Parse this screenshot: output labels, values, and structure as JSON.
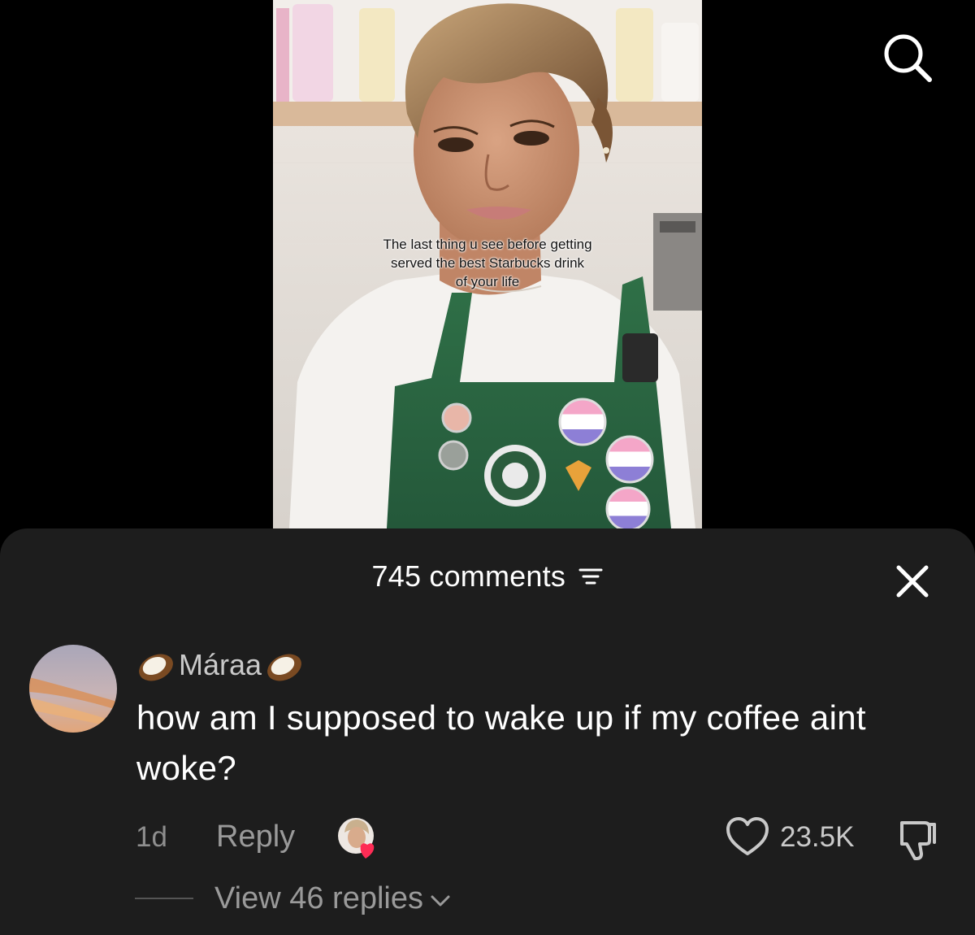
{
  "video": {
    "caption": "The last thing u see before getting\nserved the best Starbucks drink\nof your life"
  },
  "sheet": {
    "comments_label": "745 comments"
  },
  "comment": {
    "username": "Máraa",
    "username_emoji": "coconut",
    "text": "how am I supposed to wake up if my coffee aint woke?",
    "time": "1d",
    "reply_label": "Reply",
    "like_count": "23.5K",
    "view_replies_label": "View 46 replies"
  },
  "icons": {
    "search": "search-icon",
    "sort": "sort-icon",
    "close": "close-icon",
    "like": "heart-outline-icon",
    "dislike": "thumbs-down-icon",
    "creator_liked": "creator-liked-avatar-icon",
    "chevron": "chevron-down-icon"
  },
  "colors": {
    "background": "#000000",
    "sheet": "#1d1d1d",
    "muted_text": "#9a9a9a",
    "creator_heart": "#fe2c55",
    "apron_green": "#2d6b43"
  }
}
